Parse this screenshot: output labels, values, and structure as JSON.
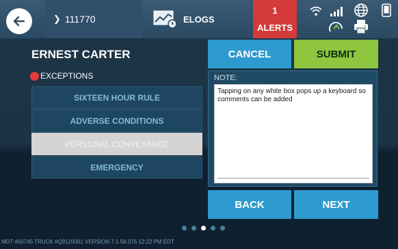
{
  "topbar": {
    "truck_number": "111770",
    "elogs_label": "ELOGS",
    "alerts_count": "1",
    "alerts_label": "ALERTS",
    "icons": [
      "back-arrow-icon",
      "chevron-right-icon",
      "elogs-chart-icon",
      "wifi-icon",
      "signal-bars-icon",
      "globe-icon",
      "gps-icon",
      "printer-icon",
      "tablet-icon"
    ]
  },
  "driver": {
    "name": "ERNEST CARTER"
  },
  "exceptions": {
    "heading": "EXCEPTIONS",
    "items": [
      {
        "label": "SIXTEEN HOUR RULE"
      },
      {
        "label": "ADVERSE CONDITIONS"
      },
      {
        "label": "PERSONAL CONVEYANCE"
      },
      {
        "label": "EMERGENCY"
      }
    ],
    "selected": "PERSONAL CONVEYANCE"
  },
  "actions": {
    "cancel_label": "CANCEL",
    "submit_label": "SUBMIT",
    "back_label": "BACK",
    "next_label": "NEXT"
  },
  "note": {
    "label": "NOTE:",
    "value": "Tapping on any white box pops up a keyboard so comments can be added"
  },
  "pager": {
    "total": 5,
    "active_index": 2
  },
  "footer": {
    "text": "MDT #50745   TRUCK #Q9120001   VERSION  7.1.58.076   12:22 PM EDT"
  },
  "colors": {
    "alerts": "#d43a3a",
    "submit": "#8ec63f",
    "action": "#2e9bd0",
    "exception_dot": "#e43b3b"
  }
}
